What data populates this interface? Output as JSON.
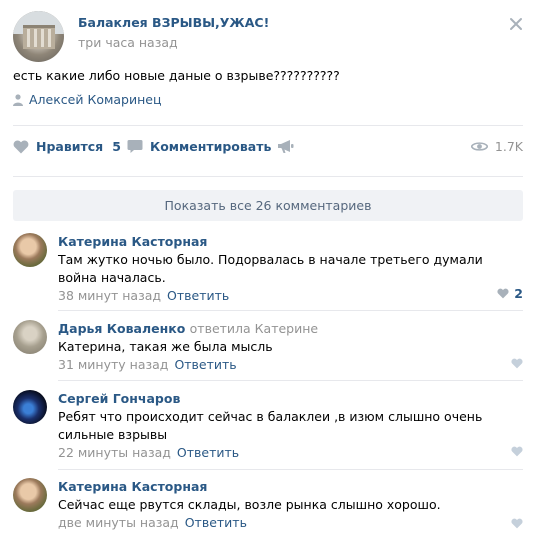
{
  "post": {
    "group_name": "Балаклея ВЗРЫВЫ,УЖАС!",
    "time": "три часа назад",
    "text": "есть какие либо новые даные о взрыве??????????",
    "signer": "Алексей Комаринец"
  },
  "actions": {
    "like_label": "Нравится",
    "like_count": "5",
    "comment_label": "Комментировать",
    "views": "1.7K"
  },
  "show_all_label": "Показать все 26 комментариев",
  "comments": [
    {
      "author": "Катерина Касторная",
      "reply_to": "",
      "text": "Там жутко ночью было. Подорвалась в начале третьего думали война началась.",
      "time": "38 минут назад",
      "reply_label": "Ответить",
      "likes": "2"
    },
    {
      "author": "Дарья Коваленко",
      "reply_to": "ответила Катерине",
      "text": "Катерина, такая же была мысль",
      "time": "31 минуту назад",
      "reply_label": "Ответить",
      "likes": ""
    },
    {
      "author": "Сергей Гончаров",
      "reply_to": "",
      "text": "Ребят что происходит сейчас в балаклеи ,в изюм слышно очень сильные взрывы",
      "time": "22 минуты назад",
      "reply_label": "Ответить",
      "likes": ""
    },
    {
      "author": "Катерина Касторная",
      "reply_to": "",
      "text": "Сейчас еще рвутся склады, возле рынка слышно хорошо.",
      "time": "две минуты назад",
      "reply_label": "Ответить",
      "likes": ""
    }
  ],
  "colors": {
    "link": "#2a5885",
    "muted": "#939393",
    "icon": "#a8b1ba",
    "show_all_bg": "#f0f2f5"
  }
}
